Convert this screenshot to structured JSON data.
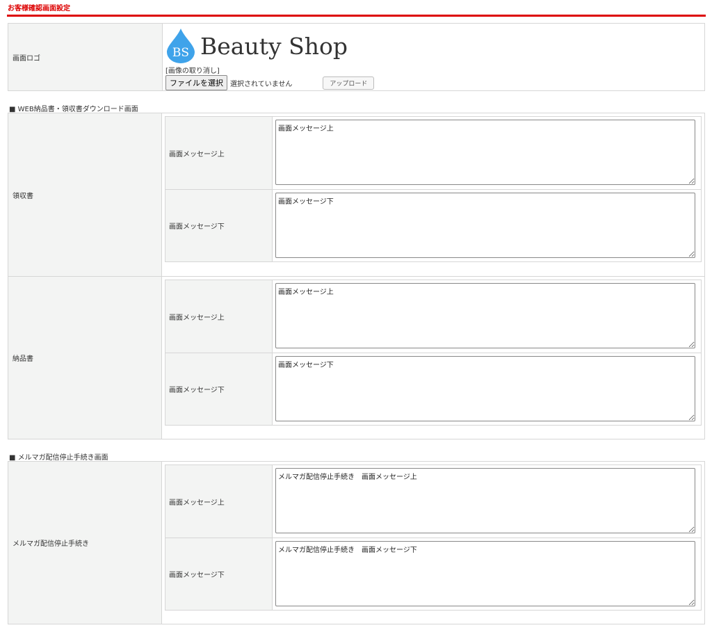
{
  "page_title": "お客様確認画面設定",
  "logo_row": {
    "label": "画面ロゴ",
    "logo_initials": "BS",
    "logo_text": "Beauty Shop",
    "cancel_image": "[画像の取り消し]",
    "file_button": "ファイルを選択",
    "file_status": "選択されていません",
    "upload_button": "アップロード"
  },
  "section1": {
    "heading": "■ WEB納品書・領収書ダウンロード画面",
    "groups": [
      {
        "label": "領収書",
        "rows": [
          {
            "label": "画面メッセージ上",
            "value": "画面メッセージ上"
          },
          {
            "label": "画面メッセージ下",
            "value": "画面メッセージ下"
          }
        ]
      },
      {
        "label": "納品書",
        "rows": [
          {
            "label": "画面メッセージ上",
            "value": "画面メッセージ上"
          },
          {
            "label": "画面メッセージ下",
            "value": "画面メッセージ下"
          }
        ]
      }
    ]
  },
  "section2": {
    "heading": "■ メルマガ配信停止手続き画面",
    "groups": [
      {
        "label": "メルマガ配信停止手続き",
        "rows": [
          {
            "label": "画面メッセージ上",
            "value": "メルマガ配信停止手続き　画面メッセージ上"
          },
          {
            "label": "画面メッセージ下",
            "value": "メルマガ配信停止手続き　画面メッセージ下"
          }
        ]
      }
    ]
  },
  "colors": {
    "accent": "#dd0000",
    "logo_blue": "#3fa3ea"
  }
}
